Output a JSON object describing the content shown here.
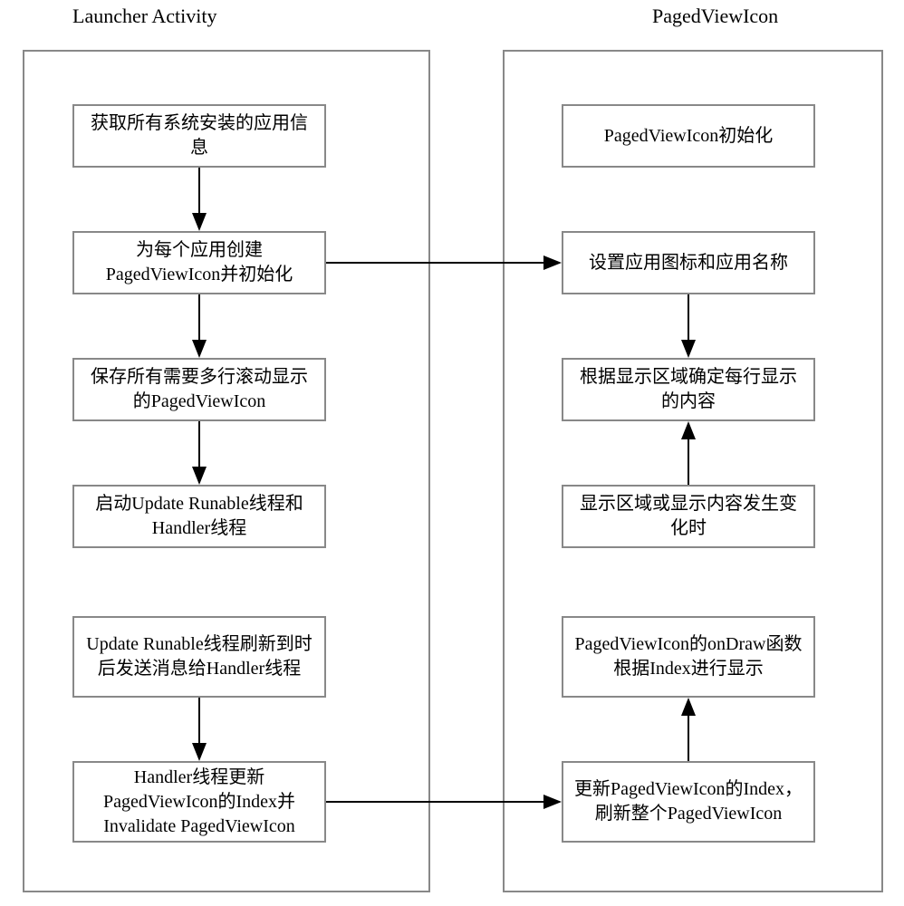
{
  "titles": {
    "left": "Launcher Activity",
    "right": "PagedViewIcon"
  },
  "left": {
    "n1": "获取所有系统安装的应用信息",
    "n2": "为每个应用创建PagedViewIcon并初始化",
    "n3": "保存所有需要多行滚动显示的PagedViewIcon",
    "n4": "启动Update Runable线程和Handler线程",
    "n5": "Update Runable线程刷新到时后发送消息给Handler线程",
    "n6": "Handler线程更新PagedViewIcon的Index并Invalidate PagedViewIcon"
  },
  "right": {
    "r1": "PagedViewIcon初始化",
    "r2": "设置应用图标和应用名称",
    "r3": "根据显示区域确定每行显示的内容",
    "r4": "显示区域或显示内容发生变化时",
    "r5": "PagedViewIcon的onDraw函数根据Index进行显示",
    "r6": "更新PagedViewIcon的Index，刷新整个PagedViewIcon"
  }
}
